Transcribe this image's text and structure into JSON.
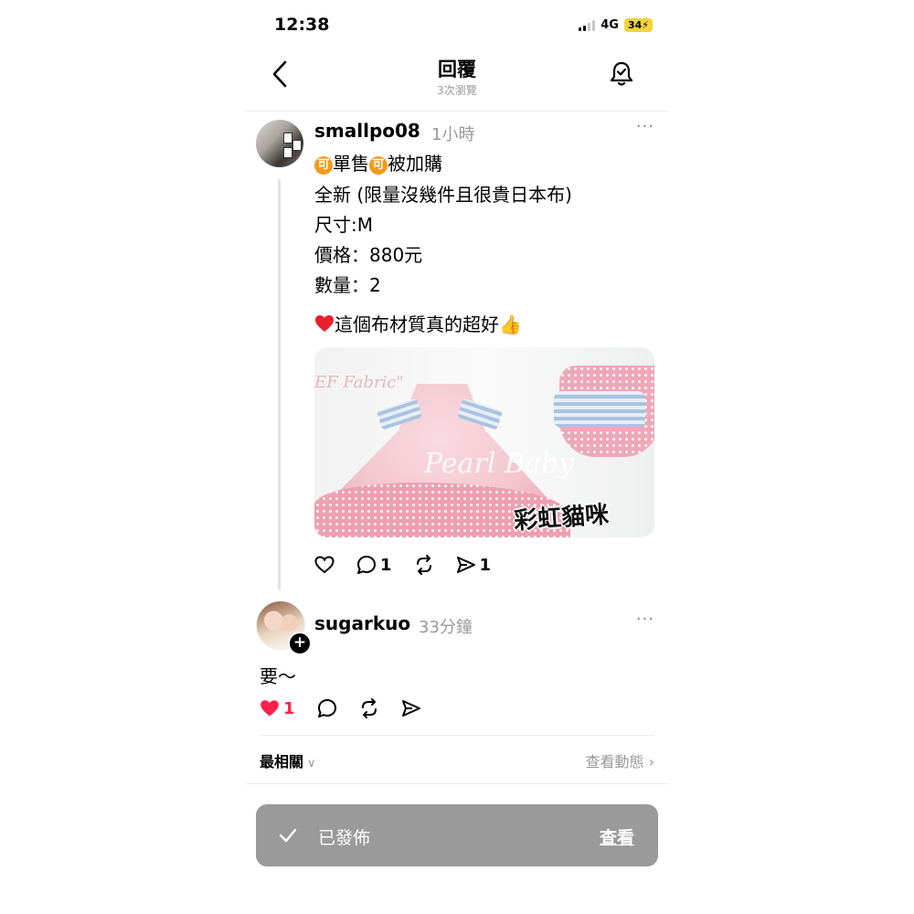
{
  "status_bar": {
    "time": "12:38",
    "network": "4G",
    "battery": "34"
  },
  "header": {
    "title": "回覆",
    "subtitle": "3次瀏覽"
  },
  "post": {
    "username": "smallpo08",
    "time_ago": "1小時",
    "badge_char": "可",
    "line1_a": "單售",
    "line1_b": "被加購",
    "line2": "全新 (限量沒幾件且很貴日本布)",
    "line3": "尺寸:M",
    "line4": "價格：880元",
    "line5": "數量：2",
    "line6": "這個布材質真的超好",
    "image": {
      "fabric_text": "EF Fabric\"",
      "watermark": "Pearl Baby",
      "stamp": "彩虹貓咪"
    },
    "actions": {
      "comments": "1",
      "shares": "1"
    }
  },
  "reply": {
    "username": "sugarkuo",
    "time_ago": "33分鐘",
    "text": "要～",
    "actions": {
      "likes": "1"
    }
  },
  "sort": {
    "label": "最相關",
    "activity_label": "查看動態"
  },
  "toast": {
    "message": "已發佈",
    "link": "查看"
  },
  "colors": {
    "like_red": "#ff1f4b",
    "badge_orange": "#f39a1c",
    "toast_bg": "#9a9a9a"
  }
}
